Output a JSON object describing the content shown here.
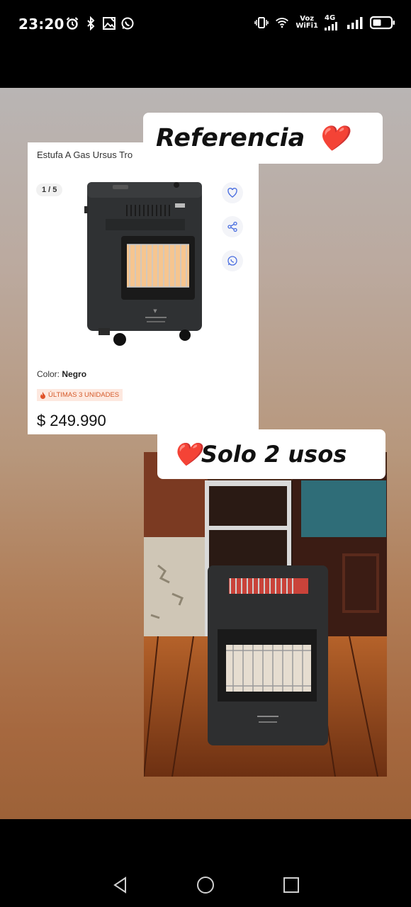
{
  "status_bar": {
    "time": "23:20",
    "left_icons": [
      "alarm-icon",
      "bluetooth-icon",
      "gallery-icon",
      "whatsapp-icon"
    ],
    "right_icons": [
      "vibrate-icon",
      "wifi-icon",
      "voz-wifi-icon",
      "cellular-4g-icon",
      "cellular-icon",
      "battery-icon"
    ],
    "voz_line1": "Voz",
    "voz_line2": "WiFi1",
    "network": "4G"
  },
  "story": {
    "sticker_top": {
      "text": "Referencia",
      "emoji": "❤️"
    },
    "sticker_bottom": {
      "emoji": "❤️",
      "text": "Solo 2 usos"
    },
    "product_card": {
      "title": "Estufa A Gas Ursus Tro",
      "pager": "1 / 5",
      "actions": [
        "heart-icon",
        "share-icon",
        "whatsapp-icon"
      ],
      "color_label": "Color:",
      "color_value": "Negro",
      "stock_badge": "ÚLTIMAS 3 UNIDADES",
      "currency": "$",
      "price": "249.990"
    }
  },
  "colors": {
    "badge_text": "#d55a2a",
    "badge_bg": "#fde8df",
    "heart_red": "#e02a2a"
  },
  "nav_bar": {
    "buttons": [
      "back-icon",
      "home-icon",
      "recents-icon"
    ]
  }
}
